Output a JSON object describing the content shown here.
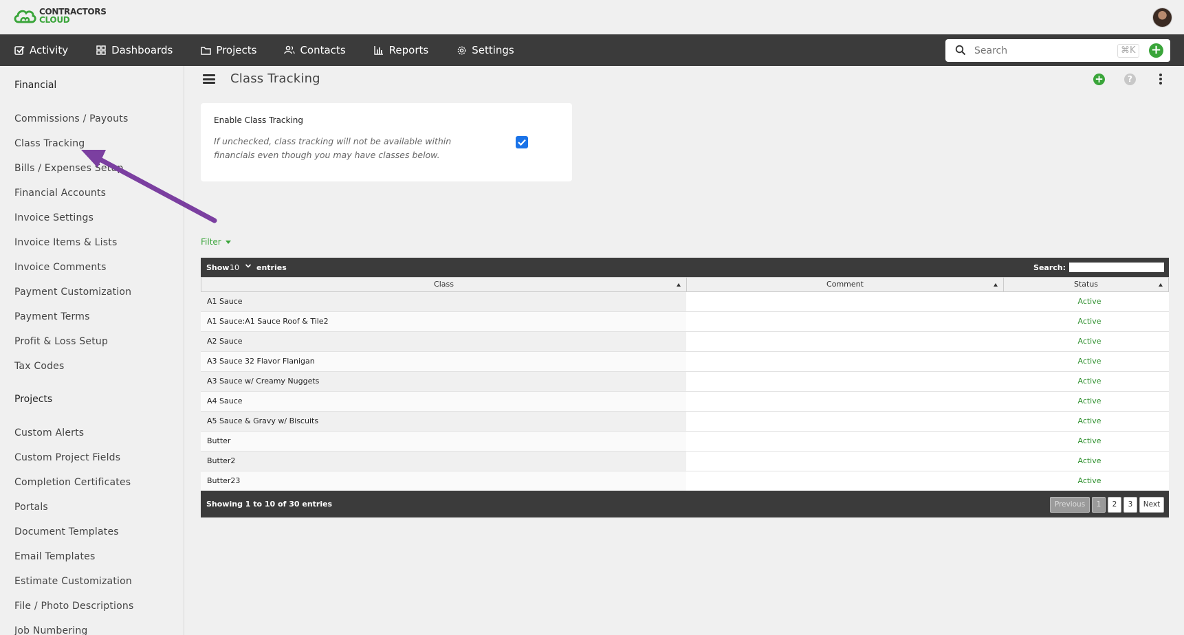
{
  "brand": {
    "line1": "CONTRACTORS",
    "line2": "CLOUD",
    "green": "#3aa53a"
  },
  "nav": {
    "items": [
      {
        "label": "Activity",
        "icon": "checkbox-icon"
      },
      {
        "label": "Dashboards",
        "icon": "grid-icon"
      },
      {
        "label": "Projects",
        "icon": "folder-icon"
      },
      {
        "label": "Contacts",
        "icon": "people-icon"
      },
      {
        "label": "Reports",
        "icon": "bar-chart-icon"
      },
      {
        "label": "Settings",
        "icon": "gear-icon"
      }
    ],
    "search_placeholder": "Search",
    "shortcut": "⌘K"
  },
  "sidebar": {
    "financial_heading": "Financial",
    "financial_items": [
      "Commissions / Payouts",
      "Class Tracking",
      "Bills / Expenses Setup",
      "Financial Accounts",
      "Invoice Settings",
      "Invoice Items & Lists",
      "Invoice Comments",
      "Payment Customization",
      "Payment Terms",
      "Profit & Loss Setup",
      "Tax Codes"
    ],
    "projects_heading": "Projects",
    "projects_items": [
      "Custom Alerts",
      "Custom Project Fields",
      "Completion Certificates",
      "Portals",
      "Document Templates",
      "Email Templates",
      "Estimate Customization",
      "File / Photo Descriptions",
      "Job Numbering"
    ]
  },
  "page": {
    "title": "Class Tracking",
    "setting_label": "Enable Class Tracking",
    "setting_help": "If unchecked, class tracking will not be available within financials even though you may have classes below.",
    "setting_checked": true,
    "filter_label": "Filter"
  },
  "table": {
    "show_label": "Show",
    "page_size": "10",
    "entries_label": "entries",
    "search_label": "Search:",
    "columns": [
      "Class",
      "Comment",
      "Status"
    ],
    "rows": [
      {
        "class": "A1 Sauce",
        "comment": "",
        "status": "Active"
      },
      {
        "class": "A1 Sauce:A1 Sauce Roof & Tile2",
        "comment": "",
        "status": "Active"
      },
      {
        "class": "A2 Sauce",
        "comment": "",
        "status": "Active"
      },
      {
        "class": "A3 Sauce 32 Flavor Flanigan",
        "comment": "",
        "status": "Active"
      },
      {
        "class": "A3 Sauce w/ Creamy Nuggets",
        "comment": "",
        "status": "Active"
      },
      {
        "class": "A4 Sauce",
        "comment": "",
        "status": "Active"
      },
      {
        "class": "A5 Sauce & Gravy w/ Biscuits",
        "comment": "",
        "status": "Active"
      },
      {
        "class": "Butter",
        "comment": "",
        "status": "Active"
      },
      {
        "class": "Butter2",
        "comment": "",
        "status": "Active"
      },
      {
        "class": "Butter23",
        "comment": "",
        "status": "Active"
      }
    ],
    "info": "Showing 1 to 10 of 30 entries",
    "pagination": {
      "previous": "Previous",
      "pages": [
        "1",
        "2",
        "3"
      ],
      "next": "Next"
    }
  },
  "annotation": {
    "arrow_color": "#7b3fa0"
  }
}
